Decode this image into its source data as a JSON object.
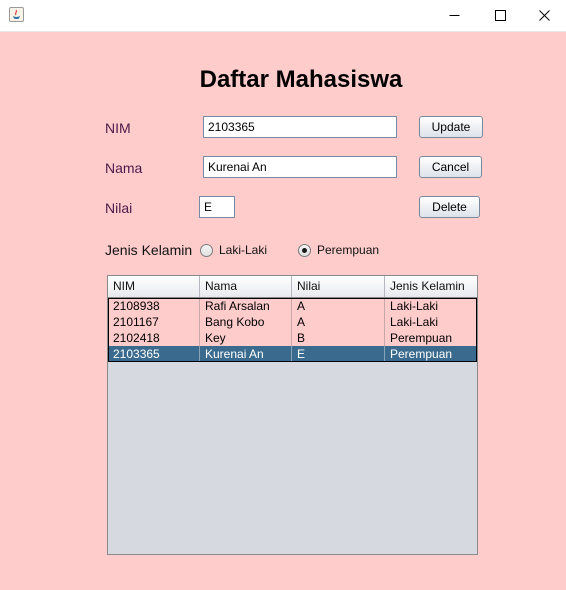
{
  "window": {
    "minimize_icon": "minimize-icon",
    "maximize_icon": "maximize-icon",
    "close_icon": "close-icon"
  },
  "form": {
    "title": "Daftar Mahasiswa",
    "nim_label": "NIM",
    "nim_value": "2103365",
    "nama_label": "Nama",
    "nama_value": "Kurenai An",
    "nilai_label": "Nilai",
    "nilai_value": "E",
    "gender_label": "Jenis Kelamin",
    "gender_options": [
      {
        "label": "Laki-Laki",
        "selected": false
      },
      {
        "label": "Perempuan",
        "selected": true
      }
    ]
  },
  "buttons": {
    "update": "Update",
    "cancel": "Cancel",
    "delete": "Delete"
  },
  "table": {
    "columns": [
      "NIM",
      "Nama",
      "Nilai",
      "Jenis Kelamin"
    ],
    "rows": [
      [
        "2108938",
        "Rafi Arsalan",
        "A",
        "Laki-Laki"
      ],
      [
        "2101167",
        "Bang Kobo",
        "A",
        "Laki-Laki"
      ],
      [
        "2102418",
        "Key",
        "B",
        "Perempuan"
      ],
      [
        "2103365",
        "Kurenai An",
        "E",
        "Perempuan"
      ]
    ],
    "selected_row": 3
  },
  "colors": {
    "background": "#ffcccc",
    "selection": "#3a6b8e"
  }
}
